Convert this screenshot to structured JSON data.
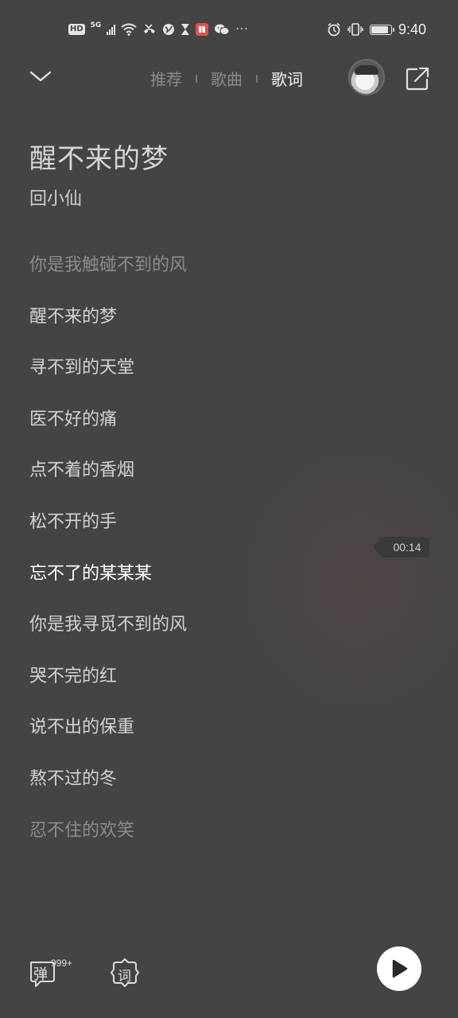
{
  "status_bar": {
    "hd_label": "HD",
    "network_label": "5G",
    "time": "9:40",
    "battery_level": 0.9,
    "more_dots": "···"
  },
  "topnav": {
    "tabs": [
      {
        "label": "推荐"
      },
      {
        "label": "歌曲"
      },
      {
        "label": "歌词"
      }
    ],
    "active_tab": "歌词"
  },
  "song": {
    "title": "醒不来的梦",
    "artist": "回小仙"
  },
  "lyrics": [
    "你是我触碰不到的风",
    "醒不来的梦",
    "寻不到的天堂",
    "医不好的痛",
    "点不着的香烟",
    "松不开的手",
    "忘不了的某某某",
    "你是我寻觅不到的风",
    "哭不完的红",
    "说不出的保重",
    "熬不过的冬",
    "忍不住的欢笑"
  ],
  "current_lyric_index": 6,
  "time_tag": "00:14",
  "bottom": {
    "danmu_label": "弹",
    "danmu_count": "999+",
    "ci_label": "词"
  },
  "colors": {
    "background": "#454444",
    "active_text": "#ffffff",
    "inactive_tab": "#8a8a8a"
  }
}
